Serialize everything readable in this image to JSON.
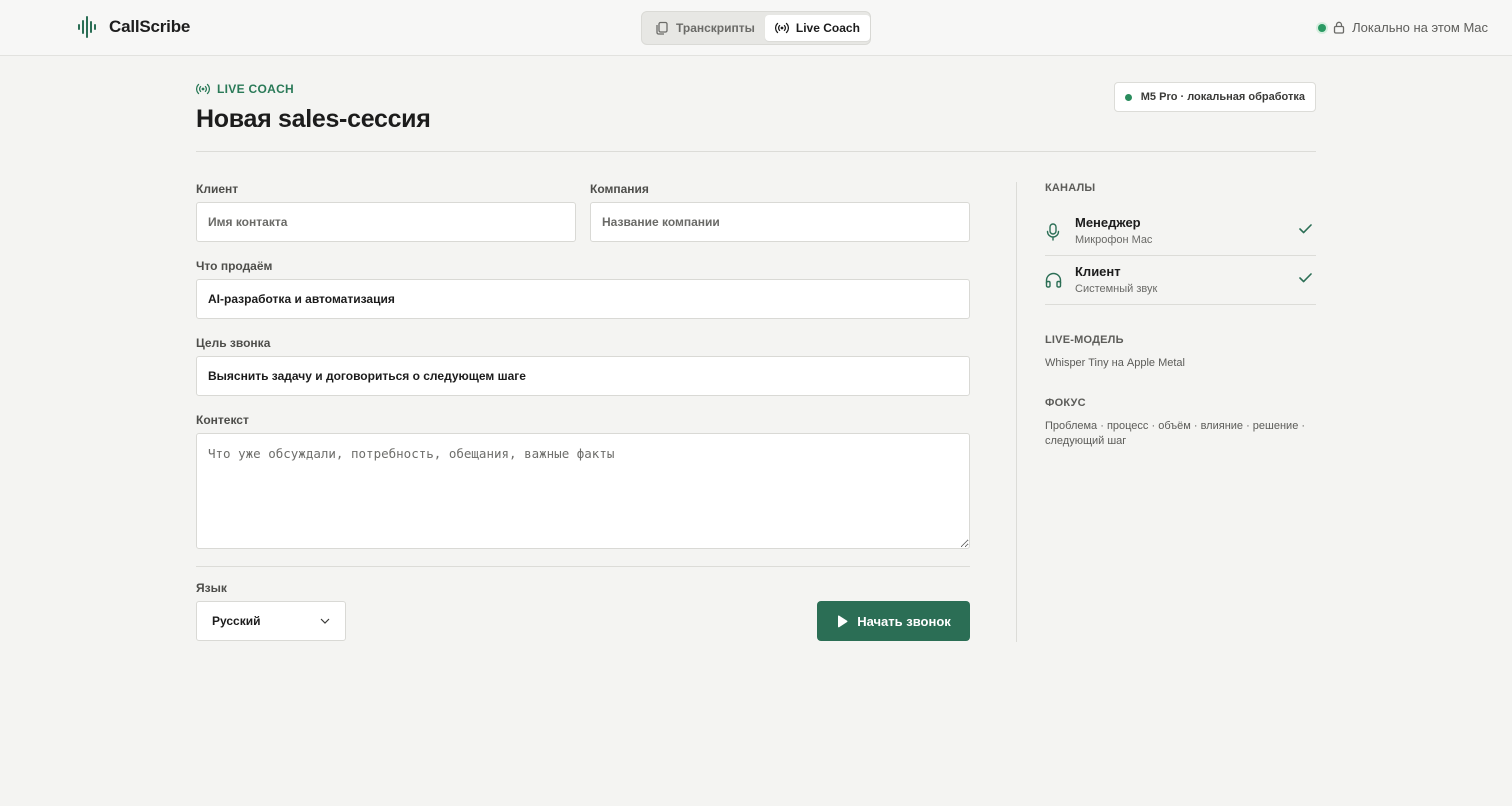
{
  "app": {
    "name": "CallScribe"
  },
  "nav": {
    "tabs": [
      {
        "label": "Транскрипты",
        "icon": "copy-icon",
        "active": false
      },
      {
        "label": "Live Coach",
        "icon": "broadcast-icon",
        "active": true
      }
    ]
  },
  "status": {
    "local_label": "Локально на этом Mac",
    "color": "#2a9a63",
    "icon": "lock-icon"
  },
  "header": {
    "eyebrow": "LIVE COACH",
    "title": "Новая sales-сессия",
    "badge": "M5 Pro · локальная обработка"
  },
  "form": {
    "client": {
      "label": "Клиент",
      "placeholder": "Имя контакта",
      "value": ""
    },
    "company": {
      "label": "Компания",
      "placeholder": "Название компании",
      "value": ""
    },
    "product": {
      "label": "Что продаём",
      "value": "AI-разработка и автоматизация"
    },
    "goal": {
      "label": "Цель звонка",
      "value": "Выяснить задачу и договориться о следующем шаге"
    },
    "context": {
      "label": "Контекст",
      "placeholder": "Что уже обсуждали, потребность, обещания, важные факты",
      "value": ""
    },
    "language": {
      "label": "Язык",
      "selected": "Русский"
    },
    "start_button": "Начать звонок"
  },
  "sidebar": {
    "channels_title": "КАНАЛЫ",
    "channels": [
      {
        "name": "Менеджер",
        "source": "Микрофон Mac",
        "icon": "microphone-icon",
        "enabled": true
      },
      {
        "name": "Клиент",
        "source": "Системный звук",
        "icon": "headphones-icon",
        "enabled": true
      }
    ],
    "model_title": "LIVE-МОДЕЛЬ",
    "model_value": "Whisper Tiny на Apple Metal",
    "focus_title": "ФОКУС",
    "focus_value": "Проблема · процесс · объём · влияние · решение · следующий шаг"
  },
  "colors": {
    "accent": "#2b6e55",
    "accent_text": "#2a7a58",
    "status_green": "#2a9a63",
    "background": "#f4f4f2"
  }
}
